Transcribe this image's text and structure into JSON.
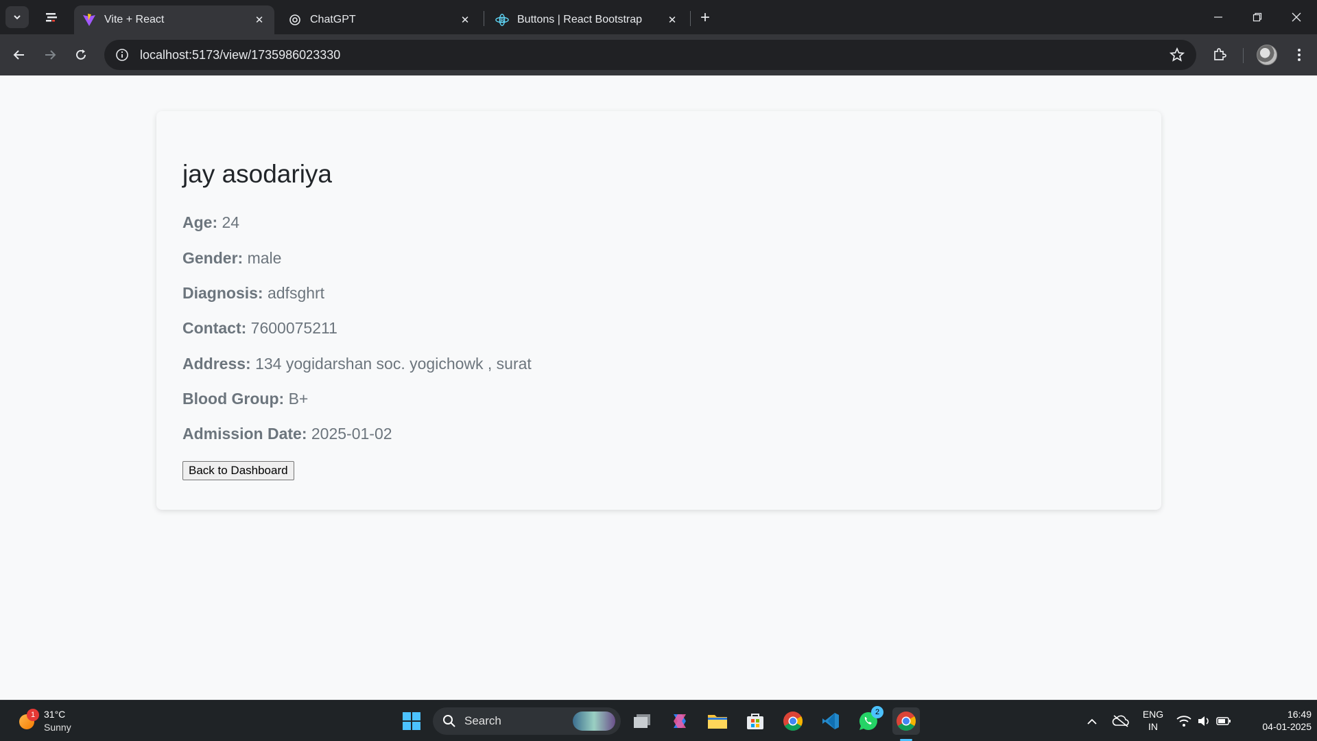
{
  "browser": {
    "tabs": [
      {
        "title": "Vite + React",
        "icon": "vite-icon",
        "active": true
      },
      {
        "title": "ChatGPT",
        "icon": "chatgpt-icon",
        "active": false
      },
      {
        "title": "Buttons | React Bootstrap",
        "icon": "react-bootstrap-icon",
        "active": false
      }
    ],
    "url": "localhost:5173/view/1735986023330"
  },
  "patient": {
    "name": "jay asodariya",
    "fields": [
      {
        "label": "Age:",
        "value": "24"
      },
      {
        "label": "Gender:",
        "value": "male"
      },
      {
        "label": "Diagnosis:",
        "value": "adfsghrt"
      },
      {
        "label": "Contact:",
        "value": "7600075211"
      },
      {
        "label": "Address:",
        "value": "134 yogidarshan soc. yogichowk , surat"
      },
      {
        "label": "Blood Group:",
        "value": "B+"
      },
      {
        "label": "Admission Date:",
        "value": "2025-01-02"
      }
    ],
    "back_button": "Back to Dashboard"
  },
  "taskbar": {
    "weather": {
      "temp": "31°C",
      "condition": "Sunny",
      "badge": "1"
    },
    "search_label": "Search",
    "whatsapp_badge": "2",
    "language": {
      "line1": "ENG",
      "line2": "IN"
    },
    "clock": {
      "time": "16:49",
      "date": "04-01-2025"
    }
  },
  "colors": {
    "accent": "#4cc2ff",
    "text_muted": "#6c757d",
    "heading": "#212529"
  }
}
